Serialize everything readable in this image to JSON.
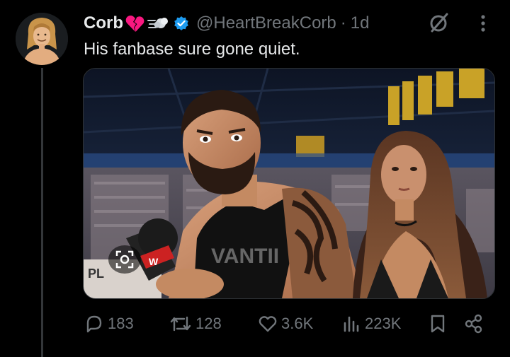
{
  "tweet": {
    "display_name": "Corb",
    "handle": "@HeartBreakCorb",
    "separator": "·",
    "time": "1d",
    "text": "His fanbase sure gone quiet.",
    "emojis": [
      "broken-heart-icon",
      "dash-icon"
    ]
  },
  "actions": {
    "replies": "183",
    "reposts": "128",
    "likes": "3.6K",
    "views": "223K"
  },
  "media_overlay": {
    "mic_flag_text": "W",
    "sign_text": "PL"
  },
  "colors": {
    "background": "#000000",
    "text": "#e7e9ea",
    "muted": "#71767b",
    "verified": "#1d9bf0",
    "thread_line": "#333639",
    "broken_heart": "#f91880"
  }
}
